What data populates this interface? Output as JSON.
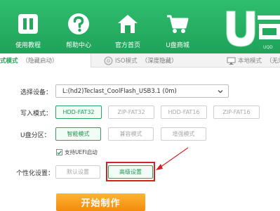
{
  "header": {
    "nav": [
      {
        "label": "使用教程",
        "icon": "book-icon"
      },
      {
        "label": "帮助中心",
        "icon": "help-icon"
      },
      {
        "label": "官方首页",
        "icon": "home-icon"
      },
      {
        "label": "U盘商城",
        "icon": "cart-icon"
      }
    ],
    "logo_text": "U启",
    "logo_sub": "UQD",
    "colors": {
      "header_green": "#25b064",
      "accent_green": "#1ea55b"
    }
  },
  "tabs": [
    {
      "name": "式模式",
      "sub": "（隐藏启动）",
      "icon": "usb-icon",
      "active": true
    },
    {
      "name": "ISO模式",
      "sub": "（深度隐藏）",
      "icon": "disc-icon",
      "active": false
    },
    {
      "name": "本地模式",
      "sub": "（无须",
      "icon": "monitor-icon",
      "active": false
    }
  ],
  "form": {
    "device_label": "选择设备：",
    "device_value": "L:(hd2)Teclast_CoolFlash_USB3.1 (0m)",
    "write_mode_label": "写入模式：",
    "write_modes": [
      {
        "label": "HDD-FAT32",
        "selected": true
      },
      {
        "label": "ZIP-FAT32",
        "selected": false
      },
      {
        "label": "HDD-FAT16",
        "selected": false
      },
      {
        "label": "ZIP-FAT16",
        "selected": false
      }
    ],
    "partition_label": "U盘分区：",
    "partitions": [
      {
        "label": "智能模式",
        "selected": true
      },
      {
        "label": "兼容模式",
        "selected": false
      },
      {
        "label": "增强模式",
        "selected": false
      }
    ],
    "uefi_label": "支持UEFI启动",
    "uefi_checked": true,
    "personalize_label": "个性化设置：",
    "personalize": [
      {
        "label": "默认设置",
        "selected": false
      },
      {
        "label": "高级设置",
        "selected": true
      }
    ],
    "start_label": "开始制作"
  },
  "annotation_color": "#d32222"
}
